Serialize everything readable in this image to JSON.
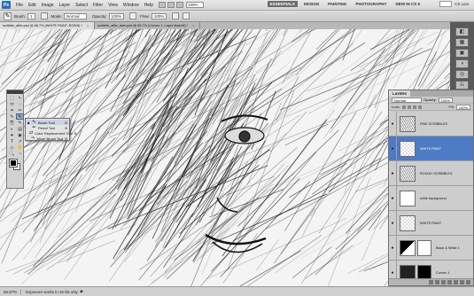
{
  "menubar": {
    "logo": "Ps",
    "items": [
      "File",
      "Edit",
      "Image",
      "Layer",
      "Select",
      "Filter",
      "View",
      "Window",
      "Help"
    ],
    "zoom": "100%",
    "workspaces": [
      "ESSENTIALS",
      "DESIGN",
      "PAINTING",
      "PHOTOGRAPHY",
      "NEW IN CS 5"
    ],
    "active_workspace": "ESSENTIALS",
    "cs_live": "CS Live"
  },
  "options": {
    "brush_label": "Brush:",
    "brush_size": "1",
    "mode_label": "Mode:",
    "mode_value": "Normal",
    "opacity_label": "Opacity:",
    "opacity_value": "100%",
    "flow_label": "Flow:",
    "flow_value": "100%"
  },
  "doc_tabs": [
    {
      "title": "scribble_after.psd @ 66.7% (WHITE PAINT, RGB/8) *",
      "close": "×"
    },
    {
      "title": "scribble_after_alim.psd @ 66.7% (Curves 1, Layer Mask/8) *",
      "close": "×"
    }
  ],
  "flyout": {
    "items": [
      {
        "bullet": "■",
        "icon": "✎",
        "label": "Brush Tool",
        "key": "B"
      },
      {
        "bullet": "",
        "icon": "✏",
        "label": "Pencil Tool",
        "key": "B"
      },
      {
        "bullet": "",
        "icon": "⇄",
        "label": "Color Replacement Tool",
        "key": "B"
      },
      {
        "bullet": "",
        "icon": "✑",
        "label": "Mixer Brush Tool",
        "key": "B"
      }
    ]
  },
  "tools": [
    "⬚",
    "↖",
    "⬭",
    "◌",
    "⌗",
    "✂",
    "✎",
    "✎",
    "⎘",
    "✎",
    "◐",
    "▤",
    "✦",
    "◉",
    "T",
    "↗",
    "◇",
    "✋",
    "🔍",
    "◔"
  ],
  "layers_panel": {
    "tab_label": "LAYERS",
    "blend_mode": "Normal",
    "opacity_label": "Opacity:",
    "opacity_value": "100%",
    "lock_label": "Lock:",
    "fill_label": "Fill:",
    "fill_value": "100%",
    "layers": [
      {
        "name": "FINE SCRIBBLES",
        "thumb": "sketch",
        "selected": false
      },
      {
        "name": "WHITE PAINT",
        "thumb": "checker",
        "selected": true
      },
      {
        "name": "ROUGH SCRIBBLES",
        "thumb": "sketch",
        "selected": false
      },
      {
        "name": "white background",
        "thumb": "white",
        "selected": false
      },
      {
        "name": "WHITE PAINT",
        "thumb": "checker",
        "selected": false
      },
      {
        "name": "Black & White 1",
        "thumb": "bw",
        "mask": "white",
        "selected": false
      },
      {
        "name": "Curves 1",
        "thumb": "curves",
        "mask": "black",
        "selected": false
      }
    ]
  },
  "statusbar": {
    "zoom": "66.67%",
    "info": "Exposure works in 32-bit only",
    "arrow": "▶"
  },
  "colors": {
    "selected_layer": "#4d7bc4",
    "active_workspace": "#6c6c6c",
    "canvas_bg": "#f2f2f2"
  }
}
